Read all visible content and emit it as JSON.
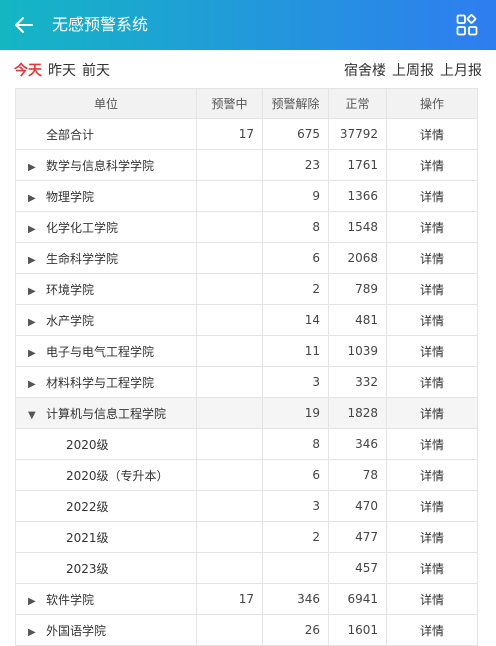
{
  "header": {
    "title": "无感预警系统"
  },
  "filters": {
    "days": [
      "今天",
      "昨天",
      "前天"
    ],
    "scopes": [
      "宿舍楼",
      "上周报",
      "上月报"
    ]
  },
  "table": {
    "columns": [
      "单位",
      "预警中",
      "预警解除",
      "正常",
      "操作"
    ],
    "rows": [
      {
        "name": "全部合计",
        "alert": "17",
        "released": "675",
        "normal": "37792",
        "action": "详情"
      },
      {
        "name": "数学与信息科学学院",
        "alert": "",
        "released": "23",
        "normal": "1761",
        "action": "详情"
      },
      {
        "name": "物理学院",
        "alert": "",
        "released": "9",
        "normal": "1366",
        "action": "详情"
      },
      {
        "name": "化学化工学院",
        "alert": "",
        "released": "8",
        "normal": "1548",
        "action": "详情"
      },
      {
        "name": "生命科学学院",
        "alert": "",
        "released": "6",
        "normal": "2068",
        "action": "详情"
      },
      {
        "name": "环境学院",
        "alert": "",
        "released": "2",
        "normal": "789",
        "action": "详情"
      },
      {
        "name": "水产学院",
        "alert": "",
        "released": "14",
        "normal": "481",
        "action": "详情"
      },
      {
        "name": "电子与电气工程学院",
        "alert": "",
        "released": "11",
        "normal": "1039",
        "action": "详情"
      },
      {
        "name": "材料科学与工程学院",
        "alert": "",
        "released": "3",
        "normal": "332",
        "action": "详情"
      },
      {
        "name": "计算机与信息工程学院",
        "alert": "",
        "released": "19",
        "normal": "1828",
        "action": "详情"
      },
      {
        "name": "2020级",
        "alert": "",
        "released": "8",
        "normal": "346",
        "action": "详情"
      },
      {
        "name": "2020级（专升本）",
        "alert": "",
        "released": "6",
        "normal": "78",
        "action": "详情"
      },
      {
        "name": "2022级",
        "alert": "",
        "released": "3",
        "normal": "470",
        "action": "详情"
      },
      {
        "name": "2021级",
        "alert": "",
        "released": "2",
        "normal": "477",
        "action": "详情"
      },
      {
        "name": "2023级",
        "alert": "",
        "released": "",
        "normal": "457",
        "action": "详情"
      },
      {
        "name": "软件学院",
        "alert": "17",
        "released": "346",
        "normal": "6941",
        "action": "详情"
      },
      {
        "name": "外国语学院",
        "alert": "",
        "released": "26",
        "normal": "1601",
        "action": "详情"
      }
    ]
  }
}
